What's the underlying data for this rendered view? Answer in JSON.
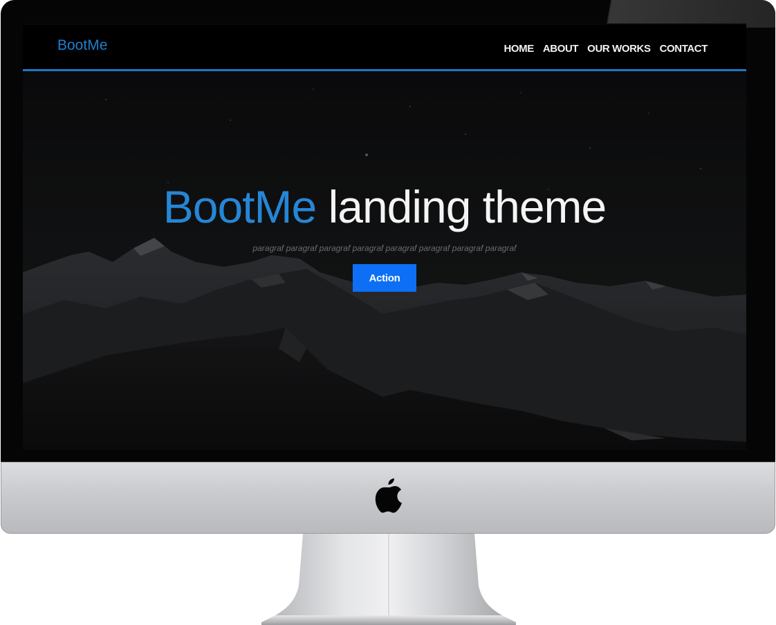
{
  "navbar": {
    "brand": "BootMe",
    "links": [
      "HOME",
      "ABOUT",
      "OUR WORKS",
      "CONTACT"
    ]
  },
  "hero": {
    "title_accent": "BootMe",
    "title_rest": "landing theme",
    "paragraph": "paragraf paragraf paragraf paragraf paragraf paragraf paragraf paragraf",
    "action_label": "Action"
  },
  "colors": {
    "accent": "#2686d6",
    "button": "#0d6ff5",
    "navbar_border": "#1f78c8"
  },
  "icons": {
    "device_logo": "apple-logo-icon"
  }
}
